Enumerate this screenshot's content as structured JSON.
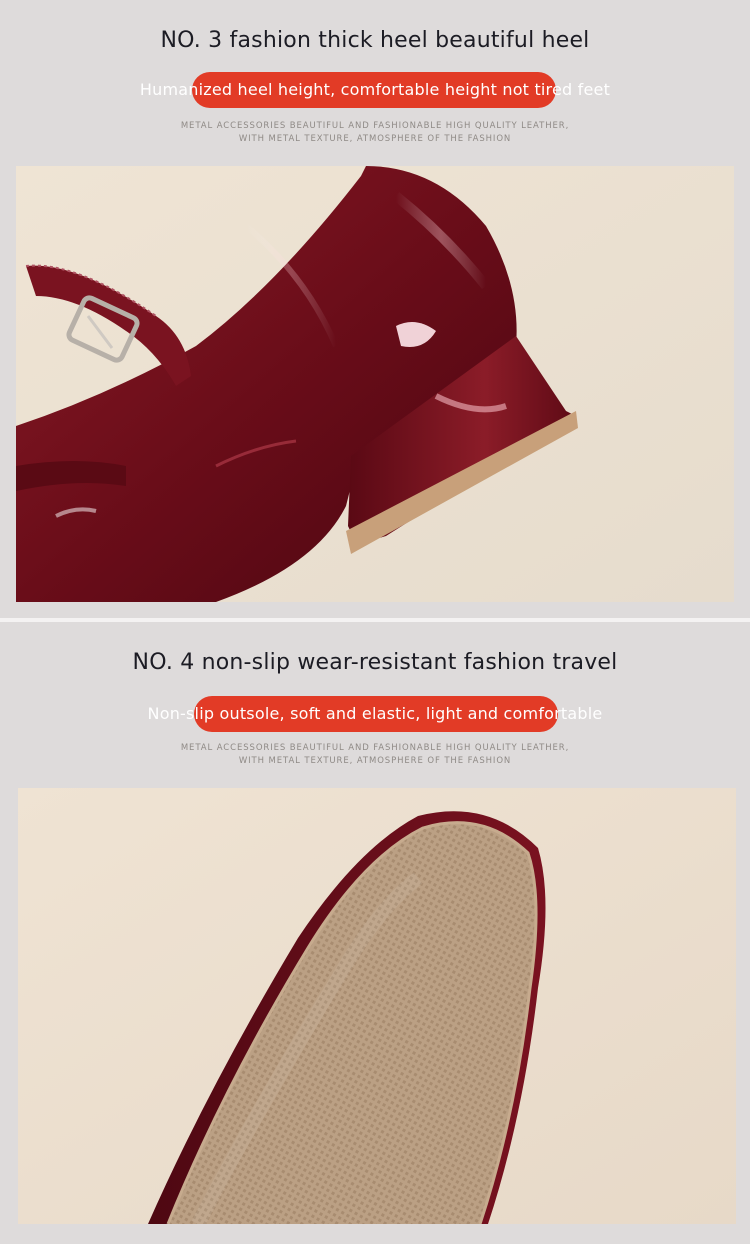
{
  "sections": [
    {
      "title": "NO. 3 fashion thick heel beautiful heel",
      "highlight": "Humanized heel height, comfortable height not tired feet",
      "subtitle_line1": "METAL ACCESSORIES BEAUTIFUL AND FASHIONABLE HIGH QUALITY LEATHER,",
      "subtitle_line2": "WITH METAL TEXTURE, ATMOSPHERE OF THE FASHION",
      "image": "burgundy-patent-mary-jane-heel-closeup"
    },
    {
      "title": "NO. 4 non-slip wear-resistant fashion travel",
      "highlight": "Non-slip outsole, soft and elastic, light and comfortable",
      "subtitle_line1": "METAL ACCESSORIES BEAUTIFUL AND FASHIONABLE HIGH QUALITY LEATHER,",
      "subtitle_line2": "WITH METAL TEXTURE, ATMOSPHERE OF THE FASHION",
      "image": "textured-outsole-closeup"
    }
  ],
  "colors": {
    "background": "#dedbdb",
    "highlight_pill": "#e23b26",
    "title_text": "#1c1c24",
    "subtitle_text": "#8f8a86",
    "shoe_leather": "#6e0f1c",
    "photo_backdrop": "#eae0d2",
    "sole": "#b79c80"
  }
}
